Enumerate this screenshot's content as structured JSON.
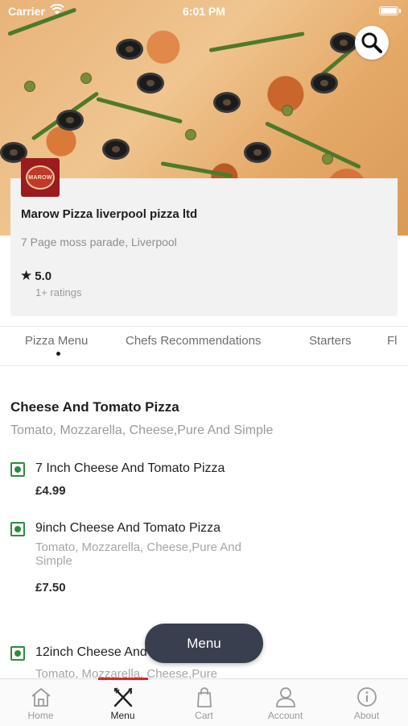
{
  "status_bar": {
    "carrier": "Carrier",
    "time": "6:01 PM"
  },
  "restaurant": {
    "logo_text": "MAROW",
    "name": "Marow Pizza liverpool pizza ltd",
    "address": "7 Page moss parade, Liverpool",
    "rating": "5.0",
    "ratings_count": "1+ ratings"
  },
  "tabs": [
    {
      "label": "Pizza Menu",
      "active": true
    },
    {
      "label": "Chefs Recommendations"
    },
    {
      "label": "Starters"
    },
    {
      "label": "Fl"
    }
  ],
  "section": {
    "title": "Cheese And Tomato Pizza",
    "description": "Tomato, Mozzarella, Cheese,Pure And Simple"
  },
  "items": [
    {
      "name": "7 Inch Cheese And Tomato Pizza",
      "description": "",
      "price": "£4.99"
    },
    {
      "name": "9inch Cheese And Tomato Pizza",
      "description": "Tomato, Mozzarella, Cheese,Pure And Simple",
      "price": "£7.50"
    },
    {
      "name": "12inch Cheese And Tomato Pizza",
      "description": "Tomato, Mozzarella, Cheese,Pure",
      "price": ""
    }
  ],
  "floating_button": {
    "label": "Menu"
  },
  "bottom_nav": [
    {
      "label": "Home",
      "icon": "home-icon"
    },
    {
      "label": "Menu",
      "icon": "fork-knife-icon",
      "active": true
    },
    {
      "label": "Cart",
      "icon": "shopping-bag-icon"
    },
    {
      "label": "Account",
      "icon": "user-icon"
    },
    {
      "label": "About",
      "icon": "info-icon"
    }
  ],
  "colors": {
    "accent": "#d9262c",
    "veg": "#2e8b3e",
    "pill": "#3a3f4f",
    "logo_bg": "#9b1c1f"
  }
}
